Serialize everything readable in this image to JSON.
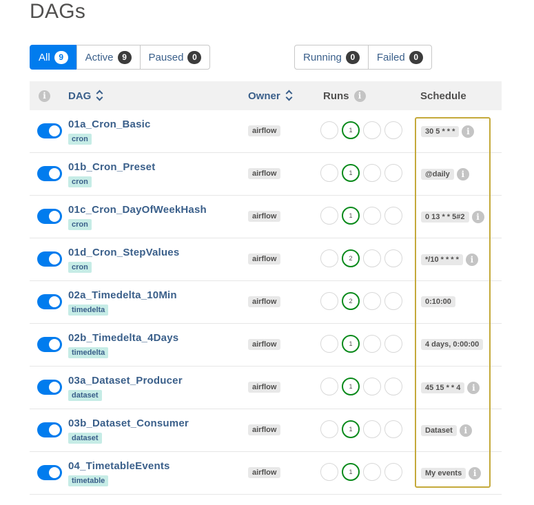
{
  "page_title": "DAGs",
  "filters": {
    "all": {
      "label": "All",
      "count": "9"
    },
    "active": {
      "label": "Active",
      "count": "9"
    },
    "paused": {
      "label": "Paused",
      "count": "0"
    },
    "running": {
      "label": "Running",
      "count": "0"
    },
    "failed": {
      "label": "Failed",
      "count": "0"
    }
  },
  "columns": {
    "dag": "DAG",
    "owner": "Owner",
    "runs": "Runs",
    "schedule": "Schedule"
  },
  "colors": {
    "accent": "#017cee",
    "success": "#0a8a1b",
    "highlight": "#c4a93a"
  },
  "rows": [
    {
      "dag_id": "01a_Cron_Basic",
      "tag": "cron",
      "owner": "airflow",
      "run_count": "1",
      "schedule": "30 5 * * *",
      "schedule_info": true
    },
    {
      "dag_id": "01b_Cron_Preset",
      "tag": "cron",
      "owner": "airflow",
      "run_count": "1",
      "schedule": "@daily",
      "schedule_info": true
    },
    {
      "dag_id": "01c_Cron_DayOfWeekHash",
      "tag": "cron",
      "owner": "airflow",
      "run_count": "1",
      "schedule": "0 13 * * 5#2",
      "schedule_info": true
    },
    {
      "dag_id": "01d_Cron_StepValues",
      "tag": "cron",
      "owner": "airflow",
      "run_count": "2",
      "schedule": "*/10 * * * *",
      "schedule_info": true
    },
    {
      "dag_id": "02a_Timedelta_10Min",
      "tag": "timedelta",
      "owner": "airflow",
      "run_count": "2",
      "schedule": "0:10:00",
      "schedule_info": false
    },
    {
      "dag_id": "02b_Timedelta_4Days",
      "tag": "timedelta",
      "owner": "airflow",
      "run_count": "1",
      "schedule": "4 days, 0:00:00",
      "schedule_info": false
    },
    {
      "dag_id": "03a_Dataset_Producer",
      "tag": "dataset",
      "owner": "airflow",
      "run_count": "1",
      "schedule": "45 15 * * 4",
      "schedule_info": true
    },
    {
      "dag_id": "03b_Dataset_Consumer",
      "tag": "dataset",
      "owner": "airflow",
      "run_count": "1",
      "schedule": "Dataset",
      "schedule_info": true
    },
    {
      "dag_id": "04_TimetableEvents",
      "tag": "timetable",
      "owner": "airflow",
      "run_count": "1",
      "schedule": "My events",
      "schedule_info": true
    }
  ]
}
